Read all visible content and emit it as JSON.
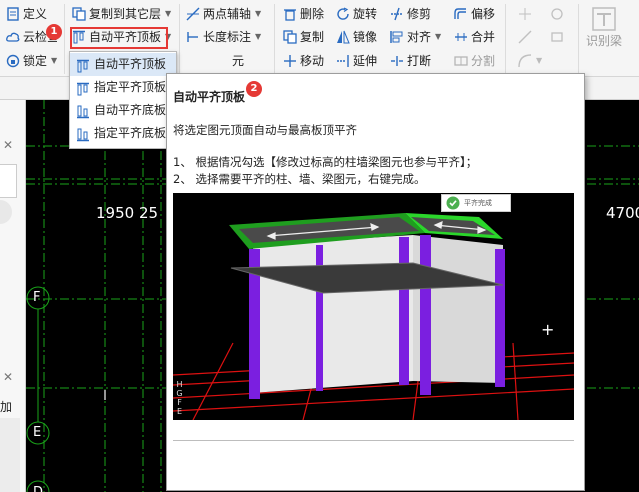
{
  "ribbon": {
    "define": "定义",
    "cloud_check": "云检查",
    "lock": "锁定",
    "copy_to_floor": "复制到其它层",
    "auto_align_top": "自动平齐顶板",
    "length_mark": "长度标注",
    "two_point_axis": "两点辅轴",
    "delete": "删除",
    "rotate": "旋转",
    "trim": "修剪",
    "offset": "偏移",
    "copy": "复制",
    "mirror": "镜像",
    "align": "对齐",
    "merge": "合并",
    "move": "移动",
    "extend": "延伸",
    "break": "打断",
    "split": "分割",
    "identify_beam": "识别梁",
    "partial_text": "元"
  },
  "dropdown": {
    "items": [
      "自动平齐顶板",
      "指定平齐顶板",
      "自动平齐底板",
      "指定平齐底板"
    ]
  },
  "badges": [
    "1",
    "2"
  ],
  "left_panel": {
    "add": "加"
  },
  "canvas": {
    "dim_left": "1950 25",
    "dim_right": "4700",
    "axis_f": "F",
    "axis_e": "E",
    "axis_d": "D"
  },
  "tooltip": {
    "title": "自动平齐顶板",
    "description": "将选定图元顶面自动与最高板顶平齐",
    "steps": [
      "1、 根据情况勾选【修改过标高的柱墙梁图元也参与平齐】；",
      "2、 选择需要平齐的柱、墙、梁图元，右键完成。"
    ],
    "image": {
      "done_label": "平齐完成",
      "grid_labels": [
        "H",
        "G",
        "F",
        "E"
      ]
    }
  },
  "colors": {
    "highlight": "#e53935",
    "column": "#7b1fe0",
    "slab": "#2bd62b",
    "grid_red": "#d11",
    "grid_green": "#1aa31a"
  }
}
